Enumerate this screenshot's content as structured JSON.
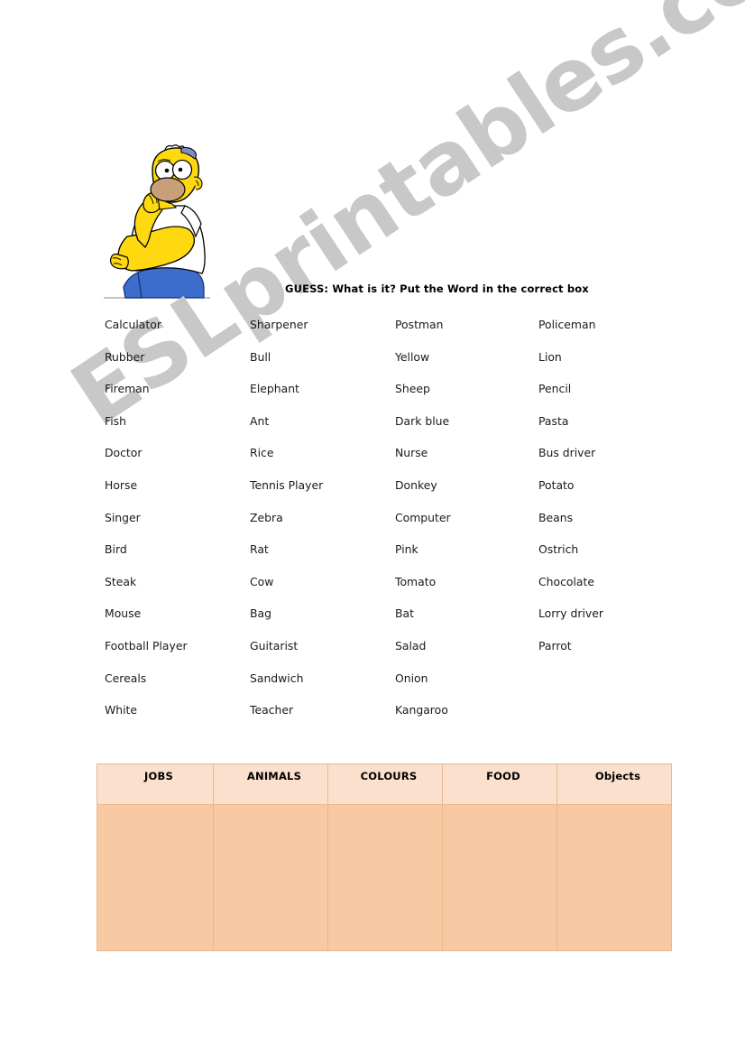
{
  "worksheet": {
    "title": "GUESS:  What is it? Put the Word in the correct box",
    "watermark": "ESLprintables.com",
    "illustration": "homer-simpson-thinking"
  },
  "word_bank": {
    "columns": [
      {
        "words": [
          "Calculator",
          "Rubber",
          "Fireman",
          "Fish",
          "Doctor",
          "Horse",
          "Singer",
          "Bird",
          "Steak",
          "Mouse",
          "Football Player",
          "Cereals",
          "White"
        ]
      },
      {
        "words": [
          "Sharpener",
          "Bull",
          "Elephant",
          "Ant",
          "Rice",
          "Tennis Player",
          "Zebra",
          "Rat",
          "Cow",
          "Bag",
          "Guitarist",
          "Sandwich",
          "Teacher"
        ]
      },
      {
        "words": [
          "Postman",
          "Yellow",
          "Sheep",
          "Dark blue",
          "Nurse",
          "Donkey",
          "Computer",
          "Pink",
          "Tomato",
          "Bat",
          "Salad",
          "Onion",
          "Kangaroo"
        ]
      },
      {
        "words": [
          "Policeman",
          "Lion",
          "Pencil",
          "Pasta",
          "Bus driver",
          "Potato",
          "Beans",
          "Ostrich",
          "Chocolate",
          "Lorry driver",
          "Parrot"
        ]
      }
    ]
  },
  "category_table": {
    "headers": [
      "JOBS",
      "ANIMALS",
      "COLOURS",
      "FOOD",
      "Objects"
    ],
    "rows": [
      [
        "",
        "",
        "",
        "",
        ""
      ]
    ]
  },
  "colors": {
    "header_fill": "#FBE0CD",
    "body_fill": "#F8C9A2",
    "table_border": "#E8B98F",
    "watermark": "#C8C8C8",
    "homer_skin": "#FFD90F",
    "homer_shirt": "#FFFFFF",
    "homer_pants": "#3C6CCC",
    "homer_stubble": "#C8A078"
  }
}
